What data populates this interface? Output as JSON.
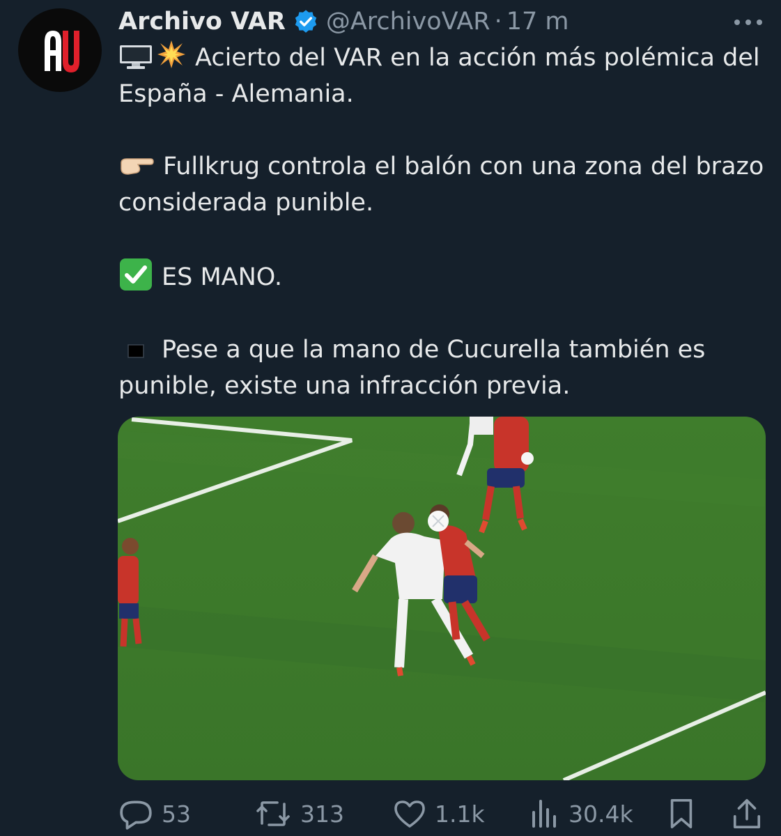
{
  "author": {
    "name": "Archivo VAR",
    "handle": "@ArchivoVAR",
    "separator": "·",
    "time": "17 m",
    "avatar_text": "AV",
    "verified": true
  },
  "tweet": {
    "p1": "Acierto del VAR en la acción más polémica del España - Alemania.",
    "p1_emojis": [
      "desktop-computer",
      "collision"
    ],
    "p2": "Fullkrug controla el balón con una zona del brazo considerada punible.",
    "p2_emoji": "pointing-right",
    "p3": "ES MANO.",
    "p3_emoji": "check-mark-button",
    "p4": "Pese a que la mano de Cucurella también es punible, existe una infracción previa.",
    "p4_emoji": "black-medium-small-square"
  },
  "media": {
    "description_icon": "football-match-photo"
  },
  "actions": {
    "replies": "53",
    "retweets": "313",
    "likes": "1.1k",
    "views": "30.4k"
  },
  "colors": {
    "background": "#15202b",
    "text": "#e7e9ea",
    "muted": "#8b98a5",
    "verified": "#1d9bf0",
    "pitch": "#3f7a2c"
  }
}
